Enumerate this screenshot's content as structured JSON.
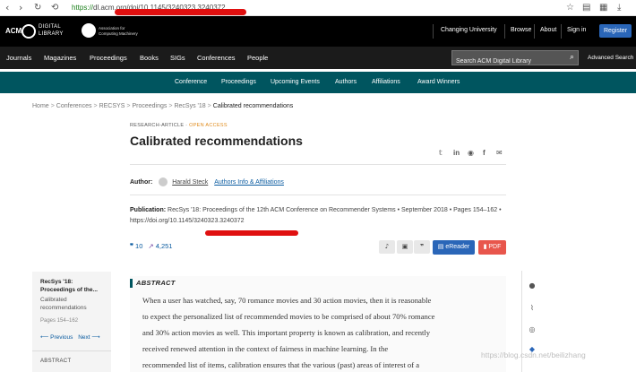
{
  "browser": {
    "url_scheme": "https://",
    "url_rest": "dl.acm.org/doi/10.1145/3240323.3240372",
    "back_icon": "chevron-left",
    "forward_icon": "chevron-right",
    "reload_icon": "reload",
    "home_icon": "home"
  },
  "topbar": {
    "logo_mark": "ACM",
    "logo_line1": "DIGITAL",
    "logo_line2": "LIBRARY",
    "inst_line1": "Association for",
    "inst_line2": "Computing Machinery",
    "links": [
      "Changing University",
      "Browse",
      "About",
      "Sign in"
    ],
    "register": "Register"
  },
  "mainnav": {
    "items": [
      "Journals",
      "Magazines",
      "Proceedings",
      "Books",
      "SIGs",
      "Conferences",
      "People"
    ],
    "search_placeholder": "Search ACM Digital Library",
    "advanced_search": "Advanced Search"
  },
  "confnav": {
    "items": [
      "Conference",
      "Proceedings",
      "Upcoming Events",
      "Authors",
      "Affiliations",
      "Award Winners"
    ]
  },
  "breadcrumb": {
    "items": [
      "Home",
      "Conferences",
      "RECSYS",
      "Proceedings",
      "RecSys '18"
    ],
    "current": "Calibrated recommendations",
    "separator": ">"
  },
  "article": {
    "type": "RESEARCH-ARTICLE",
    "access": "OPEN ACCESS",
    "title": "Calibrated recommendations",
    "author_label": "Author:",
    "author_name": "Harald Steck",
    "affiliations_link": "Authors Info & Affiliations",
    "pub_label": "Publication:",
    "pub_text": "RecSys '18: Proceedings of the 12th ACM Conference on Recommender Systems • September 2018 • Pages 154–162 •",
    "doi": "https://doi.org/10.1145/3240323.3240372",
    "citations": "10",
    "downloads": "4,251",
    "ereader": "eReader",
    "pdf": "PDF"
  },
  "toc": {
    "conference": "RecSys '18: Proceedings of the...",
    "paper": "Calibrated recommendations",
    "pages": "Pages 154–162",
    "previous": "Previous",
    "next": "Next",
    "abstract": "ABSTRACT"
  },
  "abstract": {
    "heading": "ABSTRACT",
    "lines": [
      "When a user has watched, say, 70 romance movies and 30 action movies, then it is reasonable",
      "to expect the personalized list of recommended movies to be comprised of about 70% romance",
      "and 30% action movies as well. This important property is known as calibration, and recently",
      "received renewed attention in the context of fairness in machine learning. In the",
      "recommended list of items, calibration ensures that the various (past) areas of interest of a"
    ]
  },
  "watermark": "https://blog.csdn.net/beilizhang",
  "colors": {
    "topbar": "#000000",
    "mainnav": "#1b1b1b",
    "confnav": "#00555f",
    "link": "#0a5ba0",
    "register": "#2a66b8",
    "pdf": "#e8564c",
    "open_access": "#e08a1a",
    "redaction": "#e01010"
  }
}
